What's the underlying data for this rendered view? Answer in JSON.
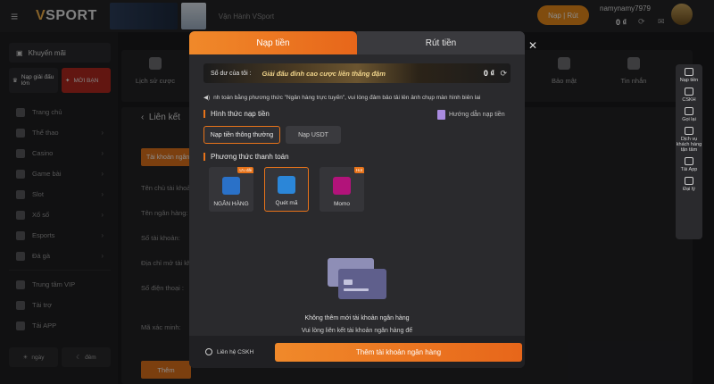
{
  "header": {
    "logo_text": "SPORT",
    "title": "Vận Hành VSport",
    "nap_rut_label": "Nạp | Rút",
    "username": "namynamy7979",
    "balance": "0 ₫"
  },
  "sidebar": {
    "promo_label": "Khuyến mãi",
    "promo_card_a": "Nạp giải đấu lớn",
    "promo_card_b": "MỜI BẠN",
    "items": [
      {
        "label": "Trang chủ"
      },
      {
        "label": "Thể thao"
      },
      {
        "label": "Casino"
      },
      {
        "label": "Game bài"
      },
      {
        "label": "Slot"
      },
      {
        "label": "Xổ số"
      },
      {
        "label": "Esports"
      },
      {
        "label": "Đá gà"
      }
    ],
    "extra": [
      {
        "label": "Trung tâm VIP"
      },
      {
        "label": "Tài trợ"
      },
      {
        "label": "Tải APP"
      }
    ],
    "theme_day": "ngày",
    "theme_night": "đêm"
  },
  "main": {
    "tabs": [
      {
        "label": "Lịch sử cược"
      },
      {
        "label": "Bảo mật"
      },
      {
        "label": "Tin nhắn"
      }
    ],
    "section_title": "Liên kết",
    "account_tab": "Tài khoản ngân",
    "fields": [
      "Tên chủ tài khoản",
      "Tên ngân hàng:",
      "Số tài khoản:",
      "Địa chỉ mở tài khoả",
      "Số điện thoại :",
      "Mã xác minh:"
    ],
    "add_label": "Thêm"
  },
  "right_bar": [
    {
      "label": "Nạp tiền"
    },
    {
      "label": "CSKH"
    },
    {
      "label": "Gọi lại"
    },
    {
      "label": "Dịch vụ khách hàng tận tâm"
    },
    {
      "label": "Tải App"
    },
    {
      "label": "Đại lý"
    }
  ],
  "modal": {
    "tab_deposit": "Nạp tiền",
    "tab_withdraw": "Rút tiền",
    "balance_label": "Số dư của tôi :",
    "banner_text": "Giải đấu đỉnh cao cược liền thắng đậm",
    "balance_value": "0 ₫",
    "marquee": "nh toán bằng phương thức \"Ngân hàng trực tuyến\", vui lòng đảm bảo tải lên ảnh chụp màn hình biên lai",
    "method_title": "Hình thức nạp tiền",
    "guide_label": "Hướng dẫn nạp tiền",
    "methods": [
      {
        "label": "Nạp tiền thông thường"
      },
      {
        "label": "Nạp USDT"
      }
    ],
    "payment_title": "Phương thức thanh toán",
    "payments": [
      {
        "label": "NGÂN HÀNG",
        "badge": "Ưu đãi",
        "color": "#2a71c8"
      },
      {
        "label": "Quét mã",
        "badge": "",
        "color": "#2b86d8"
      },
      {
        "label": "Momo",
        "badge": "Hot",
        "color": "#b2137a"
      }
    ],
    "empty_line1": "Không thêm mới tài khoản ngân hàng",
    "empty_line2": "Vui lòng liên kết tài khoản ngân hàng để",
    "support_label": "Liên hệ CSKH",
    "add_bank_label": "Thêm tài khoản ngân hàng"
  },
  "colors": {
    "accent": "#e7731a",
    "background": "#1b1b1d"
  }
}
